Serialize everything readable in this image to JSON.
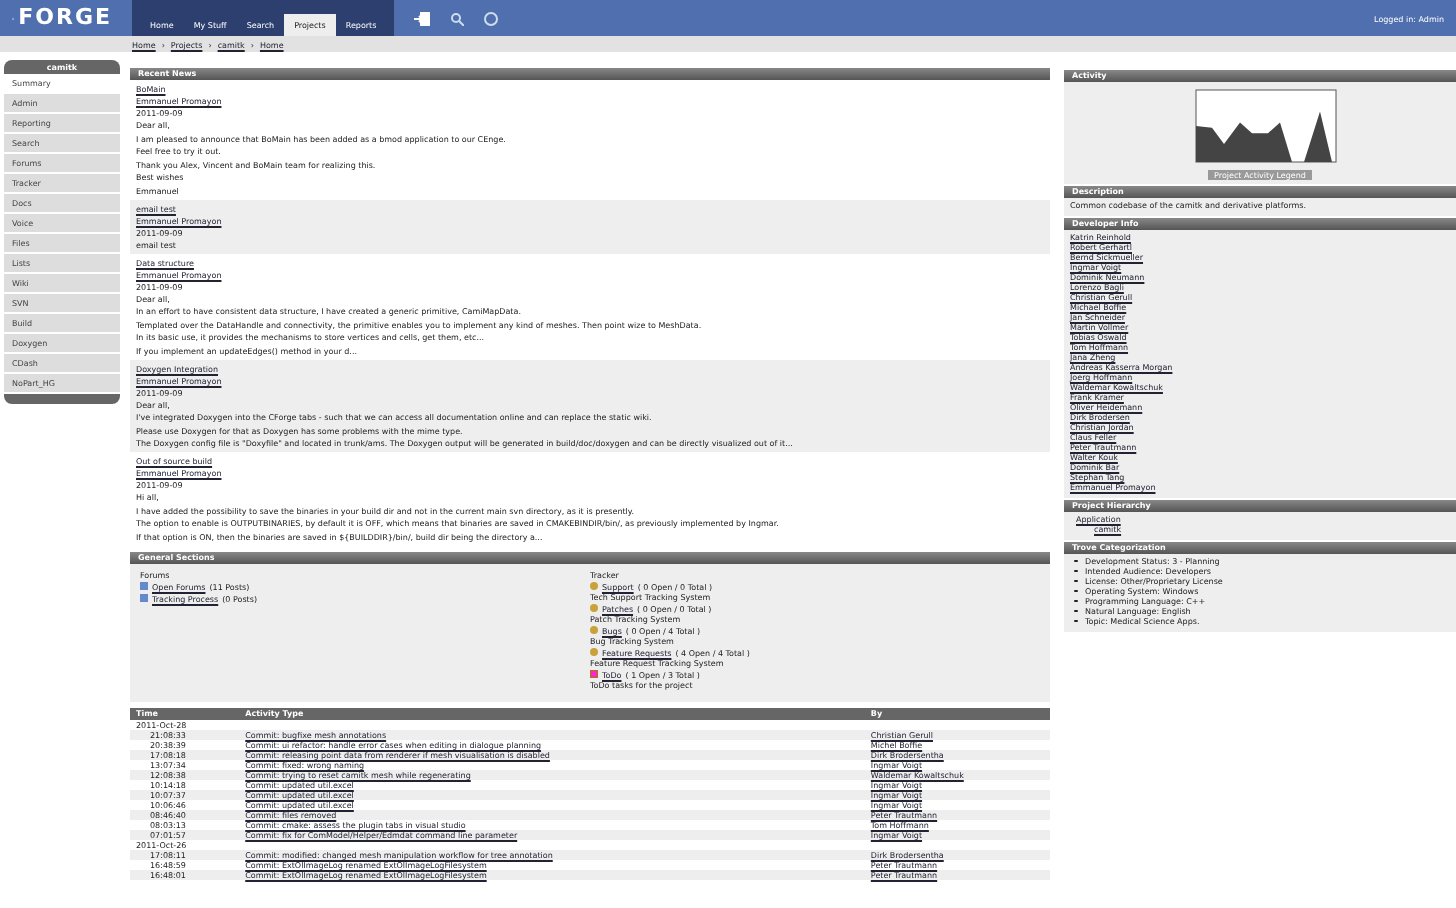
{
  "header": {
    "logo": "FORGE",
    "nav": [
      {
        "label": "Home",
        "selected": false
      },
      {
        "label": "My Stuff",
        "selected": false
      },
      {
        "label": "Search",
        "selected": false
      },
      {
        "label": "Projects",
        "selected": true
      },
      {
        "label": "Reports",
        "selected": false
      }
    ],
    "login": "Logged in: Admin"
  },
  "breadcrumb": [
    "Home",
    "Projects",
    "camitk",
    "Home"
  ],
  "breadcrumb_separator": "›",
  "sidebar": {
    "title": "camitk",
    "items": [
      {
        "label": "Summary",
        "selected": true
      },
      {
        "label": "Admin",
        "selected": false
      },
      {
        "label": "Reporting",
        "selected": false
      },
      {
        "label": "Search",
        "selected": false
      },
      {
        "label": "Forums",
        "selected": false
      },
      {
        "label": "Tracker",
        "selected": false
      },
      {
        "label": "Docs",
        "selected": false
      },
      {
        "label": "Voice",
        "selected": false
      },
      {
        "label": "Files",
        "selected": false
      },
      {
        "label": "Lists",
        "selected": false
      },
      {
        "label": "Wiki",
        "selected": false
      },
      {
        "label": "SVN",
        "selected": false
      },
      {
        "label": "Build",
        "selected": false
      },
      {
        "label": "Doxygen",
        "selected": false
      },
      {
        "label": "CDash",
        "selected": false
      },
      {
        "label": "NoPart_HG",
        "selected": false
      }
    ]
  },
  "news": {
    "title": "Recent News",
    "items": [
      {
        "title": "BoMain",
        "author": "Emmanuel Promayon",
        "date": "2011-09-09",
        "paragraphs": [
          "Dear all,",
          "I am pleased to announce that BoMain has been added as a bmod application to our CEnge.",
          "Feel free to try it out.",
          "Thank you Alex, Vincent and BoMain team for realizing this.",
          "Best wishes",
          "Emmanuel"
        ]
      },
      {
        "title": "email test",
        "author": "Emmanuel Promayon",
        "date": "2011-09-09",
        "paragraphs": [
          "email test"
        ]
      },
      {
        "title": "Data structure",
        "author": "Emmanuel Promayon",
        "date": "2011-09-09",
        "paragraphs": [
          "Dear all,",
          "In an effort to have consistent data structure, I have created a generic primitive, CamiMapData.",
          "Templated over the DataHandle and connectivity, the primitive enables you to implement any kind of meshes. Then point wize to MeshData.",
          "In its basic use, it provides the mechanisms to store vertices and cells, get them, etc...",
          "If you implement an updateEdges() method in your d..."
        ]
      },
      {
        "title": "Doxygen Integration",
        "author": "Emmanuel Promayon",
        "date": "2011-09-09",
        "paragraphs": [
          "Dear all,",
          "I've integrated Doxygen into the CForge tabs - such that we can access all documentation online and can replace the static wiki.",
          "Please use Doxygen for that as Doxygen has some problems with the mime type.",
          "The Doxygen config file is \"Doxyfile\" and located in trunk/ams. The Doxygen output will be generated in build/doc/doxygen and can be directly visualized out of it..."
        ]
      },
      {
        "title": "Out of source build",
        "author": "Emmanuel Promayon",
        "date": "2011-09-09",
        "paragraphs": [
          "Hi all,",
          "I have added the possibility to save the binaries in your build dir and not in the current main svn directory, as it is presently.",
          "The option to enable is OUTPUTBINARIES, by default it is OFF, which means that binaries are saved in CMAKEBINDIR/bin/, as previously implemented by Ingmar.",
          "If that option is ON, then the binaries are saved in ${BUILDDIR}/bin/, build dir being the directory a..."
        ]
      }
    ]
  },
  "general": {
    "title": "General Sections",
    "forums_label": "Forums",
    "forums": [
      {
        "name": "Open Forums",
        "count": "(11 Posts)"
      },
      {
        "name": "Tracking Process",
        "count": "(0 Posts)"
      }
    ],
    "tracker_label": "Tracker",
    "trackers": [
      {
        "kind": "tracker",
        "name": "Support",
        "count": "( 0 Open / 0 Total )",
        "desc": "Tech Support Tracking System"
      },
      {
        "kind": "tracker",
        "name": "Patches",
        "count": "( 0 Open / 0 Total )",
        "desc": "Patch Tracking System"
      },
      {
        "kind": "tracker",
        "name": "Bugs",
        "count": "( 0 Open / 4 Total )",
        "desc": "Bug Tracking System"
      },
      {
        "kind": "tracker",
        "name": "Feature Requests",
        "count": "( 4 Open / 4 Total )",
        "desc": "Feature Request Tracking System"
      },
      {
        "kind": "todo",
        "name": "ToDo",
        "count": "( 1 Open / 3 Total )",
        "desc": "ToDo tasks for the project"
      }
    ]
  },
  "activity_table": {
    "columns": [
      "Time",
      "Activity Type",
      "By"
    ],
    "groups": [
      {
        "date": "2011-Oct-28",
        "rows": [
          {
            "time": "21:08:33",
            "activity": "Commit: bugfixe mesh annotations",
            "by": "Christian Gerull"
          },
          {
            "time": "20:38:39",
            "activity": "Commit: ui refactor: handle error cases when editing in dialogue planning",
            "by": "Michel Boffie"
          },
          {
            "time": "17:08:18",
            "activity": "Commit: releasing point data from renderer if mesh visualisation is disabled",
            "by": "Dirk Brodersentha"
          },
          {
            "time": "13:07:34",
            "activity": "Commit: fixed: wrong naming",
            "by": "Ingmar Voigt"
          },
          {
            "time": "12:08:38",
            "activity": "Commit: trying to reset camitk mesh while regenerating",
            "by": "Waldemar Kowaltschuk"
          },
          {
            "time": "10:14:18",
            "activity": "Commit: updated util.excel",
            "by": "Ingmar Voigt"
          },
          {
            "time": "10:07:37",
            "activity": "Commit: updated util.excel",
            "by": "Ingmar Voigt"
          },
          {
            "time": "10:06:46",
            "activity": "Commit: updated util.excel",
            "by": "Ingmar Voigt"
          },
          {
            "time": "08:46:40",
            "activity": "Commit: files removed",
            "by": "Peter Trautmann"
          },
          {
            "time": "08:03:13",
            "activity": "Commit: cmake: assess the plugin tabs in visual studio",
            "by": "Tom Hoffmann"
          },
          {
            "time": "07:01:57",
            "activity": "Commit: fix for ComModel/Helper/Edmdat command line parameter",
            "by": "Ingmar Voigt"
          }
        ]
      },
      {
        "date": "2011-Oct-26",
        "rows": [
          {
            "time": "17:08:11",
            "activity": "Commit: modified: changed mesh manipulation workflow for tree annotation",
            "by": "Dirk Brodersentha"
          },
          {
            "time": "16:48:59",
            "activity": "Commit: ExtOlImageLog renamed ExtOlImageLogFilesystem",
            "by": "Peter Trautmann"
          },
          {
            "time": "16:48:01",
            "activity": "Commit: ExtOlImageLog renamed ExtOlImageLogFilesystem",
            "by": "Peter Trautmann"
          }
        ]
      }
    ]
  },
  "right": {
    "activity_title": "Activity",
    "chart_caption": "Project Activity Legend",
    "description_title": "Description",
    "description": "Common codebase of the camitk and derivative platforms.",
    "developers_title": "Developer Info",
    "developers": [
      "Katrin Reinhold",
      "Robert Gerhartl",
      "Bernd Sickmueller",
      "Ingmar Voigt",
      "Dominik Neumann",
      "Lorenzo Bagli",
      "Christian Gerull",
      "Michael Boffie",
      "Jan Schneider",
      "Martin Vollmer",
      "Tobias Oswald",
      "Tom Hoffmann",
      "Jana Zheng",
      "Andreas Kasserra Morgan",
      "Joerg Hoffmann",
      "Waldemar Kowaltschuk",
      "Frank Kramer",
      "Oliver Heidemann",
      "Dirk Brodersen",
      "Christian Jordan",
      "Claus Feller",
      "Peter Trautmann",
      "Walter Kouk",
      "Dominik Bar",
      "Stephan Tang",
      "Emmanuel Promayon"
    ],
    "hierarchy_title": "Project Hierarchy",
    "hierarchy": [
      {
        "label": "Application",
        "children": [
          {
            "label": "camitk"
          }
        ]
      }
    ],
    "trove_title": "Trove Categorization",
    "trove": [
      "Development Status: 3 - Planning",
      "Intended Audience: Developers",
      "License: Other/Proprietary License",
      "Operating System: Windows",
      "Programming Language: C++",
      "Natural Language: English",
      "Topic: Medical Science Apps."
    ]
  }
}
